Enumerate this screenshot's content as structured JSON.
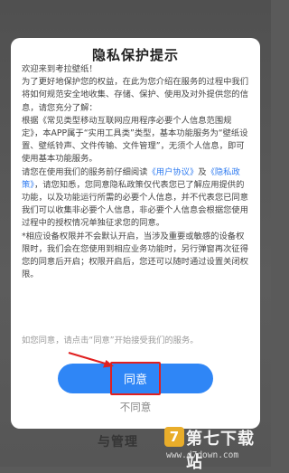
{
  "background": {
    "bottom_text": "与管理"
  },
  "dialog": {
    "title": "隐私保护提示",
    "greeting": "欢迎来到考拉壁纸！",
    "para1": "为了更好地保护您的权益，在此为您介绍在服务的过程中我们将如何规范安全地收集、存储、保护、使用及对外提供您的信息，请您充分了解：",
    "para2": "根据《常见类型移动互联网应用程序必要个人信息范围规定》，本APP属于“实用工具类”类型，基本功能服务为“壁纸设置、壁纸铃声、文件传输、文件管理”，无须个人信息，即可使用基本功能服务。",
    "para3_pre": "请您在使用我们的服务前仔细阅读",
    "link_user_agreement": "《用户协议》",
    "para3_mid": "及",
    "link_privacy_policy": "《隐私政策》",
    "para3_post": "，请您知悉，您同意隐私政策仅代表您已了解应用提供的功能，以及功能运行所需的必要个人信息，并不代表您已同意我们可以收集非必要个人信息，非必要个人信息会根据您使用过程中的授权情况单独征求您的同意。",
    "para4": "*相应设备权限并不会默认开启，当涉及重要或敏感的设备权限时，我们会在您使用到相应业务功能时，另行弹窗再次征得您的同意后开启；权限开启后，您还可以随时通过设置关闭权限。",
    "note": "如您同意，请点击“同意”开始接受我们的服务。",
    "agree_label": "同意",
    "disagree_label": "不同意"
  },
  "watermark": {
    "logo_char": "7",
    "name": "第七下载站",
    "url": "www.d7down.com"
  },
  "colors": {
    "accent": "#2f86f6",
    "link": "#2f7bf0",
    "highlight": "#e02020"
  }
}
